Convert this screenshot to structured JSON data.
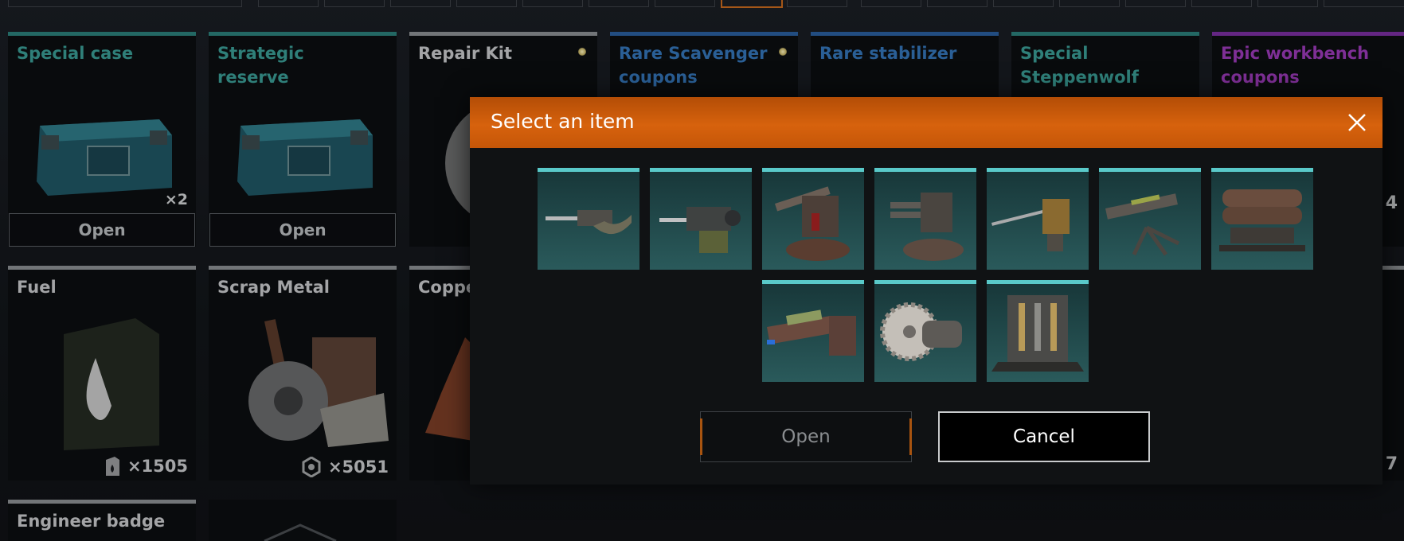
{
  "inventory": {
    "cards": [
      {
        "id": "special-case",
        "title": "Special case",
        "count": "×2",
        "button": "Open"
      },
      {
        "id": "strategic-reserve",
        "title": "Strategic reserve",
        "button": "Open"
      },
      {
        "id": "repair-kit",
        "title": "Repair Kit"
      },
      {
        "id": "rare-scavenger",
        "title": "Rare Scavenger coupons"
      },
      {
        "id": "rare-stabilizer",
        "title": "Rare stabilizer"
      },
      {
        "id": "special-steppenwolf",
        "title": "Special Steppenwolf coupons"
      },
      {
        "id": "epic-workbench",
        "title": "Epic workbench coupons",
        "count": "4"
      },
      {
        "id": "fuel",
        "title": "Fuel",
        "count": "×1505",
        "icon": "fuel-can-icon"
      },
      {
        "id": "scrap-metal",
        "title": "Scrap Metal",
        "count": "×5051",
        "icon": "scrap-gear-icon"
      },
      {
        "id": "copper",
        "title": "Coppe"
      },
      {
        "id": "last-col-count",
        "count": "7"
      },
      {
        "id": "engineer-badge",
        "title": "Engineer badge"
      }
    ]
  },
  "modal": {
    "title": "Select an item",
    "items": [
      {
        "name": "weapon-1",
        "icon": "machine-gun-icon"
      },
      {
        "name": "weapon-2",
        "icon": "heavy-machine-gun-icon"
      },
      {
        "name": "weapon-3",
        "icon": "cannon-turret-icon"
      },
      {
        "name": "weapon-4",
        "icon": "autocannon-turret-icon"
      },
      {
        "name": "weapon-5",
        "icon": "sniper-cannon-icon"
      },
      {
        "name": "weapon-6",
        "icon": "rail-cannon-icon"
      },
      {
        "name": "weapon-7",
        "icon": "rocket-launcher-icon"
      },
      {
        "name": "weapon-8",
        "icon": "laser-cannon-icon"
      },
      {
        "name": "weapon-9",
        "icon": "saw-blade-icon"
      },
      {
        "name": "weapon-10",
        "icon": "generator-module-icon"
      }
    ],
    "buttons": {
      "open": "Open",
      "cancel": "Cancel"
    }
  },
  "colors": {
    "accent_orange": "#d7620d",
    "tile_bar": "#59c9c9",
    "teal_text": "#3a9c94",
    "blue_text": "#3475b8",
    "purple_text": "#9a3ab8"
  }
}
